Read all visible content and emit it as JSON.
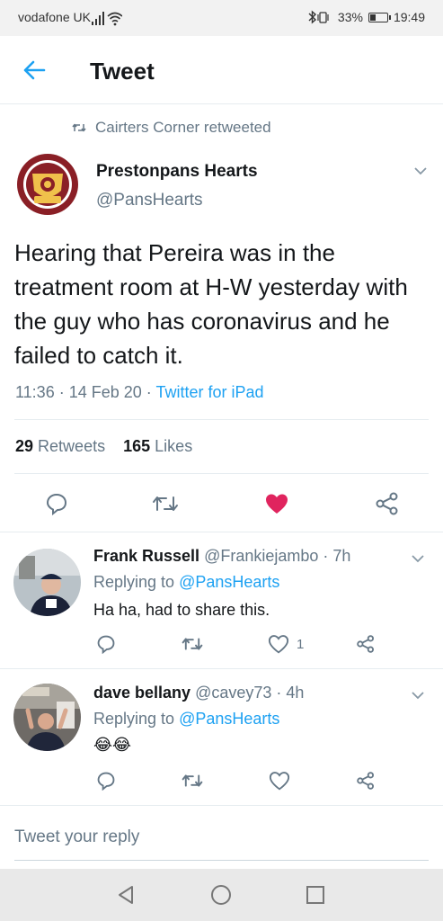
{
  "status": {
    "carrier": "vodafone UK",
    "battery": "33%",
    "battery_level": 0.33,
    "time": "19:49"
  },
  "header": {
    "title": "Tweet",
    "back_icon": "arrow-left-icon"
  },
  "tweet": {
    "retweeted_by": "Cairters Corner retweeted",
    "author_name": "Prestonpans Hearts",
    "author_handle": "@PansHearts",
    "text": "Hearing that Pereira was in the treatment room at H-W yesterday with the guy who has coronavirus and he failed to catch it.",
    "time": "11:36",
    "date": "14 Feb 20",
    "source": "Twitter for iPad",
    "retweets": "29",
    "retweets_label": "Retweets",
    "likes": "165",
    "likes_label": "Likes",
    "liked": true,
    "colors": {
      "link": "#1da1f2",
      "like": "#e0245e",
      "muted": "#657786"
    }
  },
  "replies": [
    {
      "name": "Frank Russell",
      "handle": "@Frankiejambo",
      "age": "7h",
      "replying_prefix": "Replying to",
      "replying_to": "@PansHearts",
      "text": "Ha ha, had to share this.",
      "like_count": "1"
    },
    {
      "name": "dave bellany",
      "handle": "@cavey73",
      "age": "4h",
      "replying_prefix": "Replying to",
      "replying_to": "@PansHearts",
      "text": "😂😂",
      "like_count": ""
    }
  ],
  "compose": {
    "placeholder": "Tweet your reply"
  },
  "nav": {
    "back": "triangle-back-icon",
    "home": "circle-home-icon",
    "recents": "square-recents-icon"
  }
}
